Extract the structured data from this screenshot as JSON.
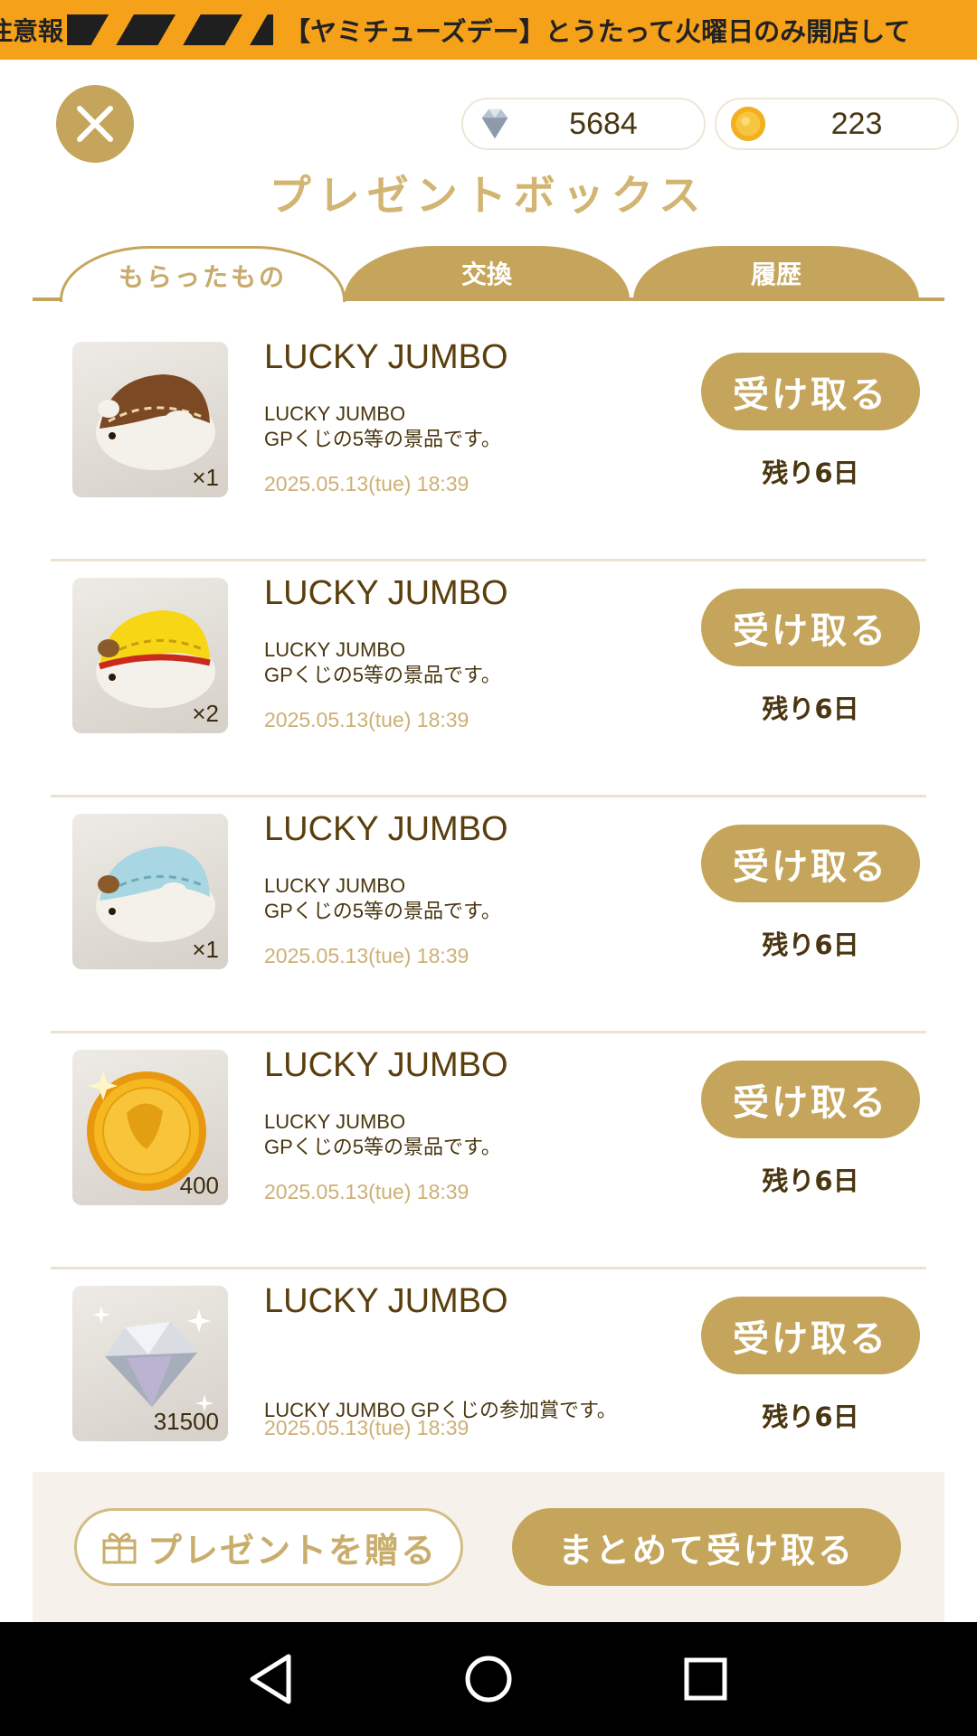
{
  "ticker": {
    "lead": "注意報",
    "text": "【ヤミチューズデー】とうたって火曜日のみ開店して"
  },
  "currencies": {
    "gem": {
      "icon": "diamond-icon",
      "value": "5684"
    },
    "coin": {
      "icon": "gold-coin-icon",
      "value": "223"
    }
  },
  "title": "プレゼントボックス",
  "tabs": [
    {
      "label": "もらったもの",
      "active": true
    },
    {
      "label": "交換",
      "active": false
    },
    {
      "label": "履歴",
      "active": false
    }
  ],
  "items": [
    {
      "name": "LUCKY JUMBO",
      "desc1": "LUCKY JUMBO",
      "desc2": "GPくじの5等の景品です。",
      "date": "2025.05.13(tue) 18:39",
      "qty": "×1",
      "thumb": "brown-hamster-plush",
      "button": "受け取る",
      "remaining": "残り6日"
    },
    {
      "name": "LUCKY JUMBO",
      "desc1": "LUCKY JUMBO",
      "desc2": "GPくじの5等の景品です。",
      "date": "2025.05.13(tue) 18:39",
      "qty": "×2",
      "thumb": "yellow-hamster-plush",
      "button": "受け取る",
      "remaining": "残り6日"
    },
    {
      "name": "LUCKY JUMBO",
      "desc1": "LUCKY JUMBO",
      "desc2": "GPくじの5等の景品です。",
      "date": "2025.05.13(tue) 18:39",
      "qty": "×1",
      "thumb": "blue-hamster-plush",
      "button": "受け取る",
      "remaining": "残り6日"
    },
    {
      "name": "LUCKY JUMBO",
      "desc1": "LUCKY JUMBO",
      "desc2": "GPくじの5等の景品です。",
      "date": "2025.05.13(tue) 18:39",
      "qty": "400",
      "thumb": "gold-coin",
      "button": "受け取る",
      "remaining": "残り6日"
    },
    {
      "name": "LUCKY JUMBO",
      "desc1": "LUCKY JUMBO GPくじの参加賞です。",
      "desc2": "",
      "date": "2025.05.13(tue) 18:39",
      "qty": "31500",
      "thumb": "diamond",
      "button": "受け取る",
      "remaining": "残り6日"
    }
  ],
  "footer": {
    "gift_label": "プレゼントを贈る",
    "bulk_label": "まとめて受け取る"
  },
  "colors": {
    "accent": "#c5a55b",
    "ticker": "#f5a11a",
    "title": "#d2b572",
    "date": "#ccb075"
  }
}
